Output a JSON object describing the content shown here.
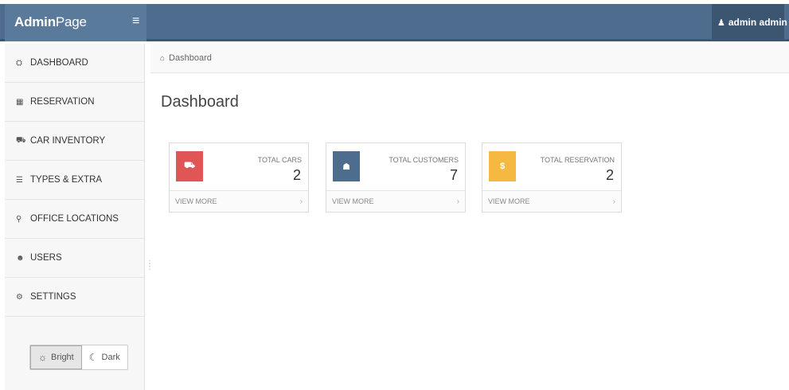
{
  "header": {
    "brand_bold": "Admin",
    "brand_rest": "Page",
    "menu_toggle": "≡",
    "user_name": "admin admin",
    "user_icon": "user-icon",
    "dropdown_caret": "▾",
    "colors": {
      "bar": "#4e6d8e",
      "brand_area": "#5a7a9c",
      "user_area": "#3c5672"
    }
  },
  "sidebar": {
    "items": [
      {
        "label": "DASHBOARD",
        "icon": "dashboard-icon",
        "glyph": "⛭"
      },
      {
        "label": "RESERVATION",
        "icon": "calendar-icon",
        "glyph": "▦"
      },
      {
        "label": "CAR INVENTORY",
        "icon": "car-icon",
        "glyph": "⛟"
      },
      {
        "label": "TYPES & EXTRA",
        "icon": "list-icon",
        "glyph": "☰"
      },
      {
        "label": "OFFICE LOCATIONS",
        "icon": "map-marker-icon",
        "glyph": "⚲"
      },
      {
        "label": "USERS",
        "icon": "users-icon",
        "glyph": "☻"
      },
      {
        "label": "SETTINGS",
        "icon": "gears-icon",
        "glyph": "⚙"
      }
    ],
    "theme": {
      "bright_label": "Bright",
      "dark_label": "Dark",
      "bright_glyph": "☼",
      "dark_glyph": "☾"
    }
  },
  "breadcrumb": {
    "home_glyph": "⌂",
    "label": "Dashboard"
  },
  "main": {
    "title": "Dashboard",
    "cards": [
      {
        "label": "TOTAL CARS",
        "value": "2",
        "footer": "VIEW MORE",
        "color": "#e05555",
        "icon": "truck-icon",
        "glyph": "⛟"
      },
      {
        "label": "TOTAL CUSTOMERS",
        "value": "7",
        "footer": "VIEW MORE",
        "color": "#4e6d8e",
        "icon": "user-icon",
        "glyph": "☗"
      },
      {
        "label": "TOTAL RESERVATION",
        "value": "2",
        "footer": "VIEW MORE",
        "color": "#f5b942",
        "icon": "dollar-icon",
        "glyph": "$"
      }
    ],
    "chevron": "›"
  }
}
